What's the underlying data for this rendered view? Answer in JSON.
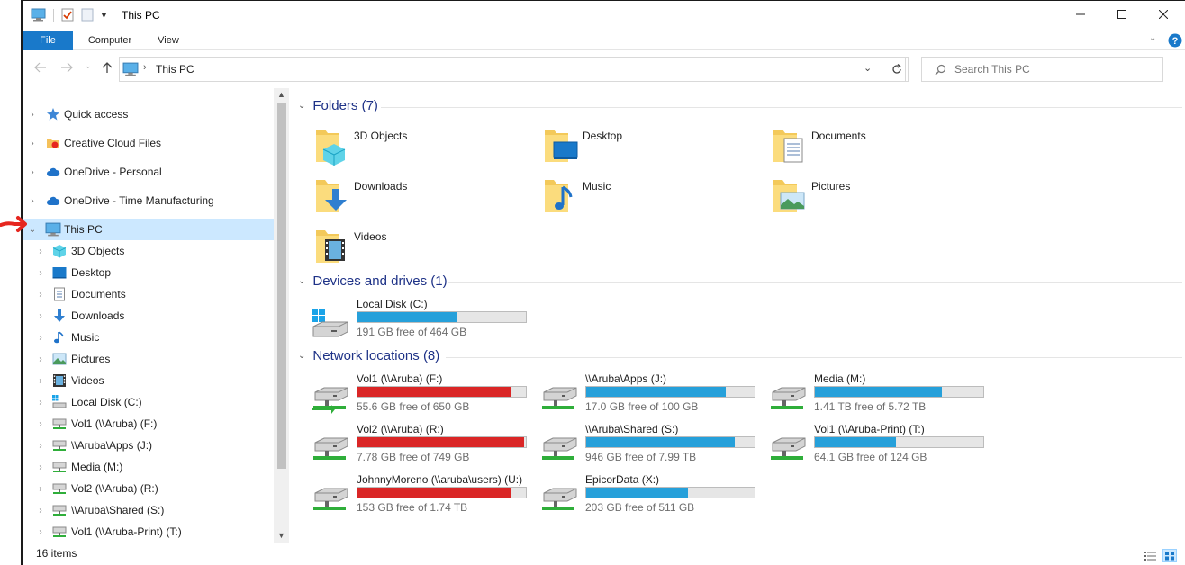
{
  "window": {
    "title": "This PC"
  },
  "ribbon": {
    "tabs": [
      "File",
      "Computer",
      "View"
    ]
  },
  "address": {
    "path": "This PC"
  },
  "search": {
    "placeholder": "Search This PC"
  },
  "nav": {
    "top": [
      {
        "label": "Quick access",
        "icon": "star-icon"
      },
      {
        "label": "Creative Cloud Files",
        "icon": "creative-cloud-icon"
      },
      {
        "label": "OneDrive - Personal",
        "icon": "cloud-icon"
      },
      {
        "label": "OneDrive - Time Manufacturing",
        "icon": "cloud-icon"
      },
      {
        "label": "This PC",
        "icon": "computer-icon"
      }
    ],
    "children": [
      {
        "label": "3D Objects",
        "icon": "3d-objects-icon"
      },
      {
        "label": "Desktop",
        "icon": "desktop-icon"
      },
      {
        "label": "Documents",
        "icon": "documents-icon"
      },
      {
        "label": "Downloads",
        "icon": "downloads-icon"
      },
      {
        "label": "Music",
        "icon": "music-icon"
      },
      {
        "label": "Pictures",
        "icon": "pictures-icon"
      },
      {
        "label": "Videos",
        "icon": "videos-icon"
      },
      {
        "label": "Local Disk (C:)",
        "icon": "local-disk-icon"
      },
      {
        "label": "Vol1 (\\\\Aruba) (F:)",
        "icon": "network-drive-icon"
      },
      {
        "label": "\\\\Aruba\\Apps (J:)",
        "icon": "network-drive-icon"
      },
      {
        "label": "Media (M:)",
        "icon": "network-drive-icon"
      },
      {
        "label": "Vol2 (\\\\Aruba) (R:)",
        "icon": "network-drive-icon"
      },
      {
        "label": "\\\\Aruba\\Shared (S:)",
        "icon": "network-drive-icon"
      },
      {
        "label": "Vol1 (\\\\Aruba-Print) (T:)",
        "icon": "network-drive-icon"
      }
    ]
  },
  "groups": {
    "folders": "Folders (7)",
    "devices": "Devices and drives (1)",
    "network": "Network locations (8)"
  },
  "folders": [
    {
      "label": "3D Objects",
      "icon": "3d-objects-folder-icon"
    },
    {
      "label": "Desktop",
      "icon": "desktop-folder-icon"
    },
    {
      "label": "Documents",
      "icon": "documents-folder-icon"
    },
    {
      "label": "Downloads",
      "icon": "downloads-folder-icon"
    },
    {
      "label": "Music",
      "icon": "music-folder-icon"
    },
    {
      "label": "Pictures",
      "icon": "pictures-folder-icon"
    },
    {
      "label": "Videos",
      "icon": "videos-folder-icon"
    }
  ],
  "devices": [
    {
      "label": "Local Disk (C:)",
      "free": "191 GB free of 464 GB",
      "used_fraction": 0.59,
      "status": "normal"
    }
  ],
  "network": [
    {
      "label": "Vol1 (\\\\Aruba) (F:)",
      "free": "55.6 GB free of 650 GB",
      "used_fraction": 0.915,
      "status": "critical"
    },
    {
      "label": "\\\\Aruba\\Apps (J:)",
      "free": "17.0 GB free of 100 GB",
      "used_fraction": 0.83,
      "status": "normal"
    },
    {
      "label": "Media (M:)",
      "free": "1.41 TB free of 5.72 TB",
      "used_fraction": 0.753,
      "status": "normal"
    },
    {
      "label": "Vol2 (\\\\Aruba) (R:)",
      "free": "7.78 GB free of 749 GB",
      "used_fraction": 0.99,
      "status": "critical"
    },
    {
      "label": "\\\\Aruba\\Shared (S:)",
      "free": "946 GB free of 7.99 TB",
      "used_fraction": 0.884,
      "status": "normal"
    },
    {
      "label": "Vol1 (\\\\Aruba-Print) (T:)",
      "free": "64.1 GB free of 124 GB",
      "used_fraction": 0.483,
      "status": "normal"
    },
    {
      "label": "JohnnyMoreno (\\\\aruba\\users) (U:)",
      "free": "153 GB free of 1.74 TB",
      "used_fraction": 0.914,
      "status": "critical"
    },
    {
      "label": "EpicorData (X:)",
      "free": "203 GB free of 511 GB",
      "used_fraction": 0.603,
      "status": "normal"
    }
  ],
  "status": {
    "count": "16 items"
  },
  "colors": {
    "accent": "#1979ca",
    "selection": "#cce8ff",
    "bar_normal": "#26a0da",
    "bar_critical": "#da2626",
    "group_header": "#1e3287"
  }
}
